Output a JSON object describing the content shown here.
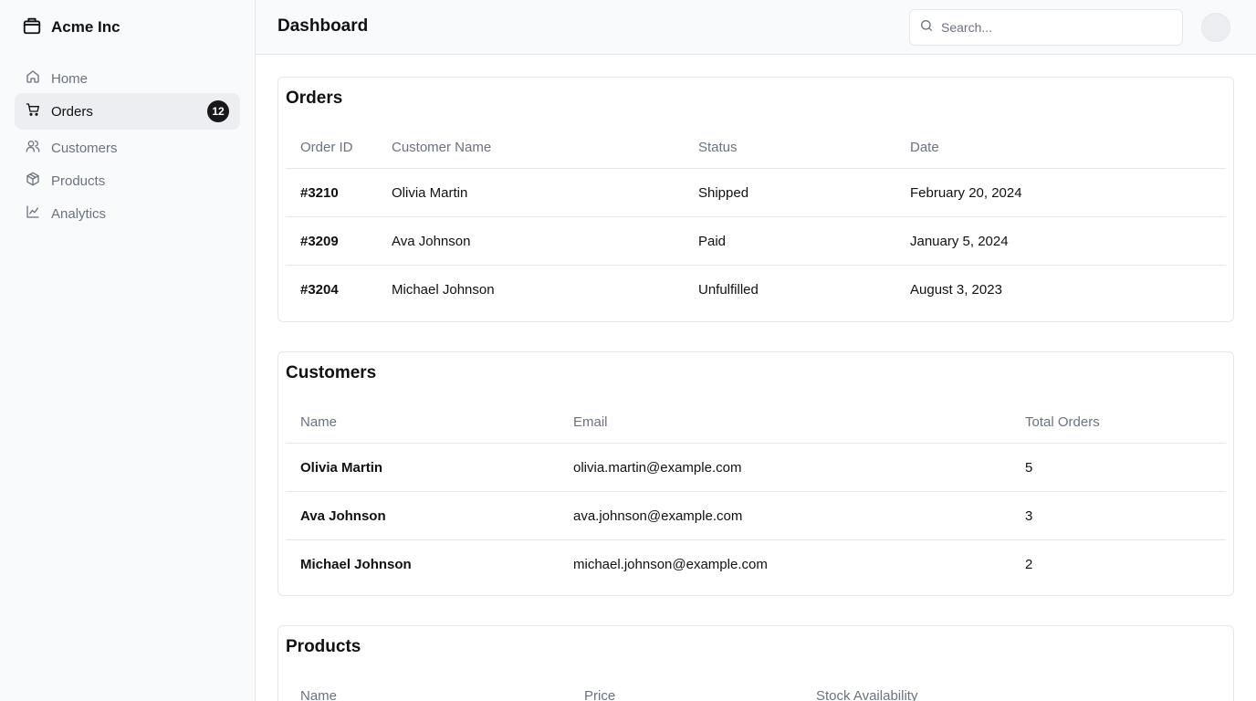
{
  "app": {
    "name": "Acme Inc"
  },
  "sidebar": {
    "items": [
      {
        "label": "Home",
        "icon": "home-icon"
      },
      {
        "label": "Orders",
        "icon": "cart-icon",
        "badge": "12",
        "active": true
      },
      {
        "label": "Customers",
        "icon": "users-icon"
      },
      {
        "label": "Products",
        "icon": "package-icon"
      },
      {
        "label": "Analytics",
        "icon": "line-chart-icon"
      }
    ]
  },
  "header": {
    "title": "Dashboard",
    "search_placeholder": "Search..."
  },
  "orders": {
    "title": "Orders",
    "columns": [
      "Order ID",
      "Customer Name",
      "Status",
      "Date"
    ],
    "rows": [
      [
        "#3210",
        "Olivia Martin",
        "Shipped",
        "February 20, 2024"
      ],
      [
        "#3209",
        "Ava Johnson",
        "Paid",
        "January 5, 2024"
      ],
      [
        "#3204",
        "Michael Johnson",
        "Unfulfilled",
        "August 3, 2023"
      ]
    ]
  },
  "customers": {
    "title": "Customers",
    "columns": [
      "Name",
      "Email",
      "Total Orders"
    ],
    "rows": [
      [
        "Olivia Martin",
        "olivia.martin@example.com",
        "5"
      ],
      [
        "Ava Johnson",
        "ava.johnson@example.com",
        "3"
      ],
      [
        "Michael Johnson",
        "michael.johnson@example.com",
        "2"
      ]
    ]
  },
  "products": {
    "title": "Products",
    "columns": [
      "Name",
      "Price",
      "Stock Availability"
    ]
  },
  "colors": {
    "sidebar_bg": "#f9fafb",
    "border": "#e5e7eb",
    "muted_text": "#6b7280",
    "badge_bg": "#18181b",
    "active_item_bg": "#eceef1"
  }
}
